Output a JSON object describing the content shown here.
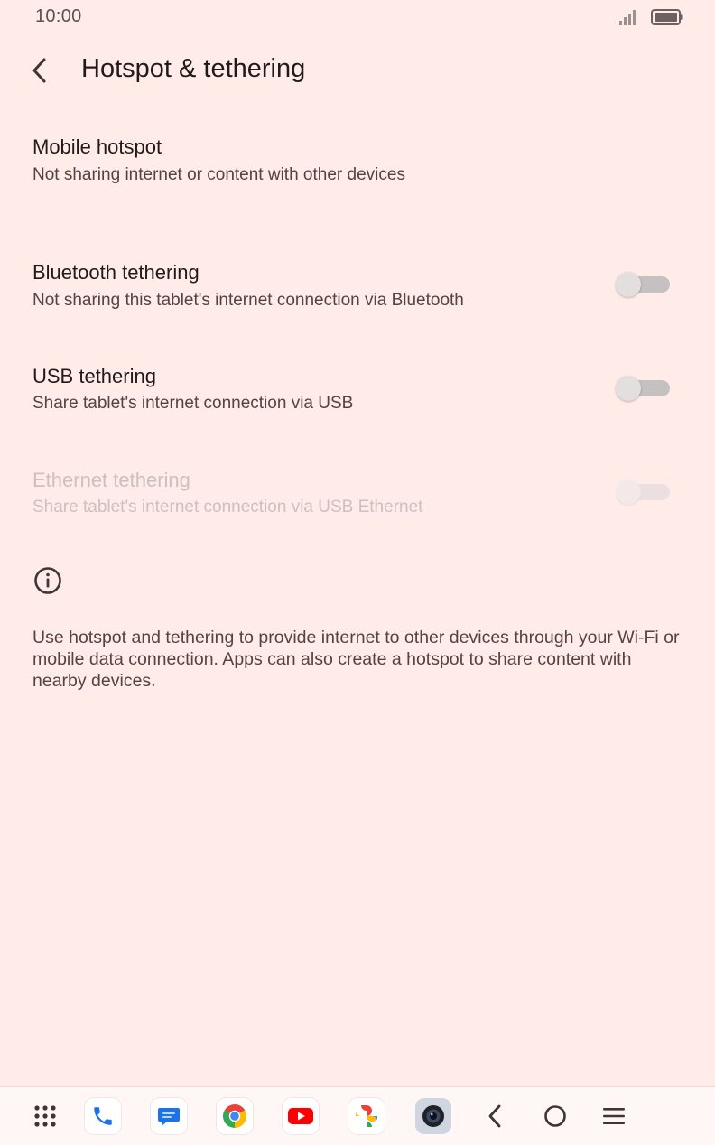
{
  "status_bar": {
    "time": "10:00"
  },
  "header": {
    "title": "Hotspot & tethering"
  },
  "preferences": [
    {
      "title": "Mobile hotspot",
      "summary": "Not sharing internet or content with other devices"
    },
    {
      "title": "Bluetooth tethering",
      "summary": "Not sharing this tablet's internet connection via Bluetooth",
      "enabled": false
    },
    {
      "title": "USB tethering",
      "summary": "Share tablet's internet connection via USB",
      "enabled": false
    },
    {
      "title": "Ethernet tethering",
      "summary": "Share tablet's internet connection via USB Ethernet",
      "enabled": false,
      "disabled": true
    }
  ],
  "footer": {
    "text": "Use hotspot and tethering to provide internet to other devices through your Wi-Fi or mobile data connection. Apps can also create a hotspot to share content with nearby devices."
  },
  "taskbar": {
    "apps": [
      "app-drawer-icon",
      "phone-icon",
      "messages-icon",
      "chrome-icon",
      "youtube-icon",
      "photos-icon",
      "camera-icon"
    ],
    "nav": [
      "back-icon",
      "home-icon",
      "recents-icon"
    ]
  },
  "colors": {
    "background": "#ffece9",
    "taskbar": "#fef7f6",
    "text_primary": "#221a19",
    "text_secondary": "#534341",
    "text_disabled": "#cdbfbd"
  }
}
